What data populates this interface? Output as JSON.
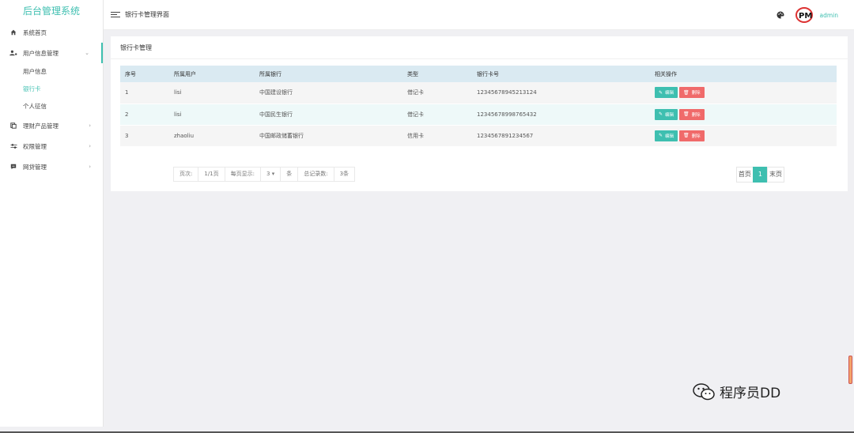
{
  "sidebar": {
    "brand": "后台管理系统",
    "home": "系统首页",
    "user_info_group": "用户信息管理",
    "user_info_children": [
      "用户信息",
      "银行卡",
      "个人征信"
    ],
    "finance": "理财产品管理",
    "permission": "权限管理",
    "loan": "网贷管理"
  },
  "topbar": {
    "title": "银行卡管理界面",
    "user": "admin",
    "avatar_text": "PM"
  },
  "card": {
    "title": "银行卡管理",
    "headers": [
      "序号",
      "所属用户",
      "所属银行",
      "类型",
      "银行卡号",
      "相关操作"
    ],
    "rows": [
      [
        "1",
        "lisi",
        "中国建设银行",
        "借记卡",
        "12345678945213124"
      ],
      [
        "2",
        "lisi",
        "中国民生银行",
        "借记卡",
        "12345678998765432"
      ],
      [
        "3",
        "zhaoliu",
        "中国邮政储蓄银行",
        "信用卡",
        "1234567891234567"
      ]
    ],
    "edit_label": "编辑",
    "delete_label": "删除"
  },
  "pagination": {
    "page_label": "页次:",
    "page_value": "1/1页",
    "per_page_label": "每页显示:",
    "per_page_value": "3",
    "per_page_unit": "条",
    "total_label": "总记录数:",
    "total_value": "3条",
    "first": "首页",
    "current": "1",
    "last": "末页"
  },
  "watermark": "程序员DD",
  "colors": {
    "accent": "#3ebfb0",
    "danger": "#f06a6a",
    "table_head": "#daeaf2"
  }
}
